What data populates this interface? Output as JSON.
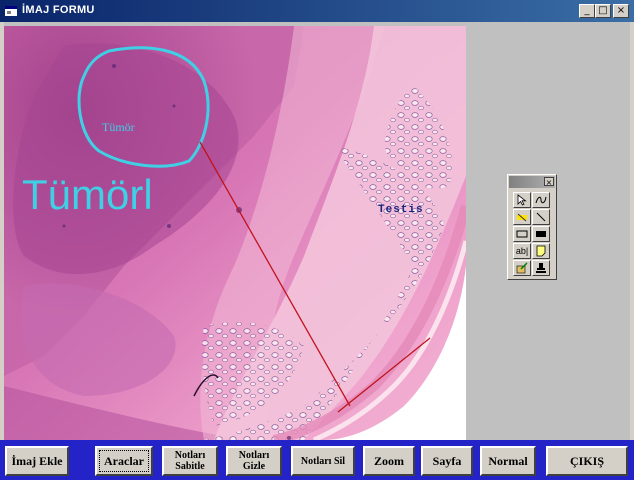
{
  "window": {
    "title": "İMAJ FORMU",
    "controls": {
      "minimize": "_",
      "maximize": "□",
      "close": "×"
    }
  },
  "image": {
    "annotations": {
      "tumor_circle_label": "Tümör",
      "tumor_big_label": "Tümörl",
      "testis_label": "Testis"
    },
    "colors": {
      "annotation_cyan": "#3fd0e6",
      "line_red": "#c0141e",
      "testis_text": "#1a237e"
    }
  },
  "toolbox": {
    "close": "×",
    "tools": [
      {
        "name": "pointer",
        "icon": "arrow-pointer-icon",
        "glyph": ""
      },
      {
        "name": "freehand",
        "icon": "freehand-icon",
        "glyph": ""
      },
      {
        "name": "highlight",
        "icon": "highlight-icon",
        "glyph": ""
      },
      {
        "name": "line",
        "icon": "line-icon",
        "glyph": ""
      },
      {
        "name": "rectangle",
        "icon": "rectangle-icon",
        "glyph": ""
      },
      {
        "name": "filled-rectangle",
        "icon": "filled-rectangle-icon",
        "glyph": ""
      },
      {
        "name": "text",
        "icon": "text-icon",
        "glyph": "ab|"
      },
      {
        "name": "note",
        "icon": "note-icon",
        "glyph": ""
      },
      {
        "name": "image-edit",
        "icon": "image-edit-icon",
        "glyph": ""
      },
      {
        "name": "stamp",
        "icon": "stamp-icon",
        "glyph": ""
      }
    ]
  },
  "buttons": {
    "imaj_ekle": "İmaj Ekle",
    "araclar": "Araclar",
    "notlari_sabitle_1": "Notları",
    "notlari_sabitle_2": "Sabitle",
    "notlari_gizle_1": "Notları",
    "notlari_gizle_2": "Gizle",
    "notlari_sil": "Notları Sil",
    "zoom": "Zoom",
    "sayfa": "Sayfa",
    "normal": "Normal",
    "cikis": "ÇIKIŞ"
  },
  "colors": {
    "titlebar_start": "#0a246a",
    "bottom_bar": "#2323c8",
    "face": "#d4d0c8"
  }
}
